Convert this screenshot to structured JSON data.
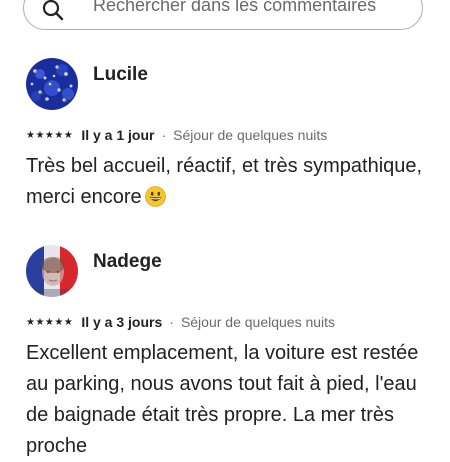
{
  "search": {
    "placeholder": "Rechercher dans les commentaires",
    "icon": "search-icon"
  },
  "reviews": [
    {
      "name": "Lucile",
      "avatar": "avatar-photo",
      "rating": 5,
      "stars": "★★★★★",
      "date": "Il y a 1 jour",
      "stay": "Séjour de quelques nuits",
      "text": "Très bel accueil, réactif, et très sympathique, merci encore",
      "emoji": "smiling-face-emoji"
    },
    {
      "name": "Nadege",
      "avatar": "avatar-photo",
      "rating": 5,
      "stars": "★★★★★",
      "date": "Il y a 3 jours",
      "stay": "Séjour de quelques nuits",
      "text": "Excellent emplacement, la voiture est restée au parking, nous avons tout fait à pied, l'eau de baignade était très propre. La mer très proche"
    }
  ],
  "separator": "·"
}
